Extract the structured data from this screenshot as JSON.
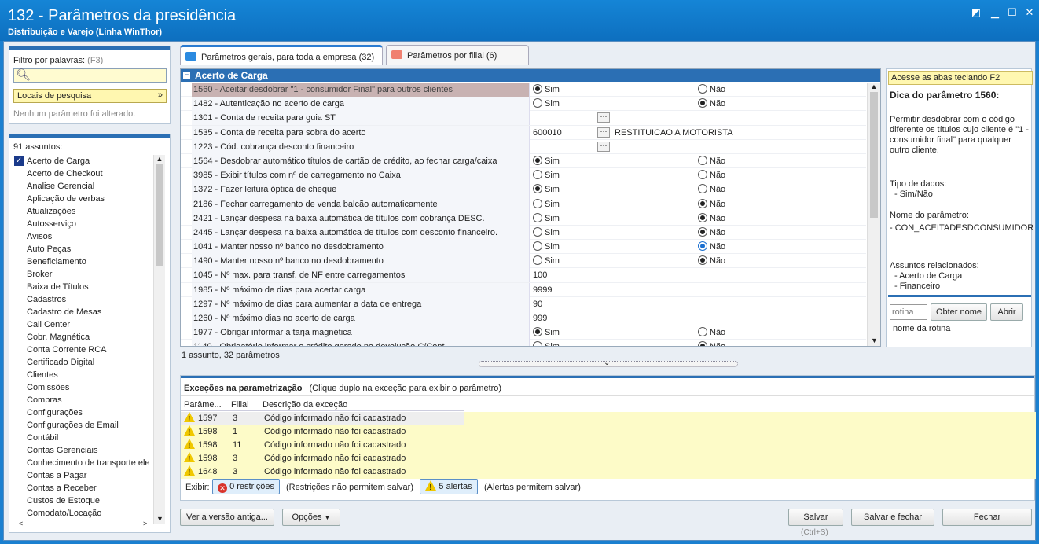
{
  "title": {
    "main": "132 - Parâmetros da presidência",
    "sub": "Distribuição e Varejo (Linha WinThor)"
  },
  "filter": {
    "label": "Filtro por palavras:",
    "shortcut": "(F3)",
    "locais": "Locais de pesquisa",
    "none_changed": "Nenhum parâmetro foi alterado."
  },
  "subjects": {
    "count": "91 assuntos:",
    "items": [
      "Acerto de Carga",
      "Acerto de Checkout",
      "Analise Gerencial",
      "Aplicação de verbas",
      "Atualizações",
      "Autosserviço",
      "Avisos",
      "Auto Peças",
      "Beneficiamento",
      "Broker",
      "Baixa de Títulos",
      "Cadastros",
      "Cadastro de Mesas",
      "Call Center",
      "Cobr. Magnética",
      "Conta Corrente RCA",
      "Certificado Digital",
      "Clientes",
      "Comissões",
      "Compras",
      "Configurações",
      "Configurações de Email",
      "Contábil",
      "Contas Gerenciais",
      "Conhecimento de transporte ele",
      "Contas a Pagar",
      "Contas a Receber",
      "Custos de Estoque",
      "Comodato/Locação"
    ]
  },
  "tabs": [
    {
      "label": "Parâmetros gerais, para toda a empresa",
      "count": "(32)"
    },
    {
      "label": "Parâmetros por filial",
      "count": "(6)"
    }
  ],
  "group": "Acerto de Carga",
  "sim": "Sim",
  "nao": "Não",
  "params": [
    {
      "name": "1560 - Aceitar desdobrar \"1 - consumidor Final\" para outros clientes",
      "type": "radio",
      "value": "sim"
    },
    {
      "name": "1482 - Autenticação no acerto de carga",
      "type": "radio",
      "value": "nao"
    },
    {
      "name": "1301 - Conta de receita para guia ST",
      "type": "lookup",
      "value": "",
      "desc": ""
    },
    {
      "name": "1535 - Conta de receita para sobra do acerto",
      "type": "lookup",
      "value": "600010",
      "desc": "RESTITUICAO A MOTORISTA"
    },
    {
      "name": "1223 - Cód. cobrança desconto financeiro",
      "type": "lookup",
      "value": "",
      "desc": ""
    },
    {
      "name": "1564 - Desdobrar automático títulos de cartão de crédito, ao fechar carga/caixa",
      "type": "radio",
      "value": "sim"
    },
    {
      "name": "3985 - Exibir títulos com nº de carregamento no Caixa",
      "type": "radio",
      "value": "none"
    },
    {
      "name": "1372 - Fazer leitura óptica de cheque",
      "type": "radio",
      "value": "sim"
    },
    {
      "name": "2186 - Fechar carregamento de venda balcão automaticamente",
      "type": "radio",
      "value": "nao"
    },
    {
      "name": "2421 - Lançar despesa na baixa automática de títulos com cobrança DESC.",
      "type": "radio",
      "value": "nao"
    },
    {
      "name": "2445 - Lançar despesa na baixa automática de títulos com desconto financeiro.",
      "type": "radio",
      "value": "nao"
    },
    {
      "name": "1041 - Manter nosso nº banco no desdobramento",
      "type": "radio",
      "value": "nao-blue"
    },
    {
      "name": "1490 - Manter nosso nº banco no desdobramento",
      "type": "radio",
      "value": "nao"
    },
    {
      "name": "1045 - Nº max. para transf. de NF entre carregamentos",
      "type": "text",
      "value": "100"
    },
    {
      "name": "1985 - Nº máximo de dias para acertar carga",
      "type": "text",
      "value": "9999"
    },
    {
      "name": "1297 - Nº máximo de dias para aumentar a data de entrega",
      "type": "text",
      "value": "90"
    },
    {
      "name": "1260 - Nº máximo dias no acerto de carga",
      "type": "text",
      "value": "999"
    },
    {
      "name": "1977 - Obrigar informar a tarja magnética",
      "type": "radio",
      "value": "sim"
    },
    {
      "name": "1140 - Obrigatório informar o crédito gerado na devolução C/Cont...",
      "type": "radio",
      "value": "nao"
    }
  ],
  "status": "1 assunto, 32 parâmetros",
  "tip": {
    "hint": "Acesse as abas teclando F2",
    "title": "Dica do parâmetro 1560:",
    "body": "Permitir desdobrar com o código diferente os títulos cujo cliente é \"1 - consumidor final\" para qualquer outro cliente.",
    "type_label": "Tipo de dados:",
    "type_value": "- Sim/Não",
    "name_label": "Nome do parâmetro:",
    "name_value": "- CON_ACEITADESDCONSUMIDOROUT",
    "rel_label": "Assuntos relacionados:",
    "rel1": "- Acerto de Carga",
    "rel2": "- Financeiro",
    "rotina_ph": "rotina",
    "obter": "Obter nome",
    "abrir": "Abrir",
    "nome_rotina": "nome da rotina"
  },
  "exceptions": {
    "title": "Exceções na parametrização",
    "note": "(Clique duplo na exceção para exibir o parâmetro)",
    "cols": [
      "Parâme...",
      "Filial",
      "Descrição da exceção"
    ],
    "rows": [
      [
        "1597",
        "3",
        "Código informado não foi cadastrado"
      ],
      [
        "1598",
        "1",
        "Código informado não foi cadastrado"
      ],
      [
        "1598",
        "11",
        "Código informado não foi cadastrado"
      ],
      [
        "1598",
        "3",
        "Código informado não foi cadastrado"
      ],
      [
        "1648",
        "3",
        "Código informado não foi cadastrado"
      ]
    ],
    "exibir": "Exibir:",
    "restr": "0 restrições",
    "restr_note": "(Restrições não permitem salvar)",
    "alerts": "5 alertas",
    "alerts_note": "(Alertas permitem salvar)"
  },
  "footer": {
    "ver": "Ver a versão antiga...",
    "opcoes": "Opções",
    "salvar": "Salvar",
    "salvar_fechar": "Salvar e fechar",
    "fechar": "Fechar",
    "shortcut": "(Ctrl+S)"
  }
}
